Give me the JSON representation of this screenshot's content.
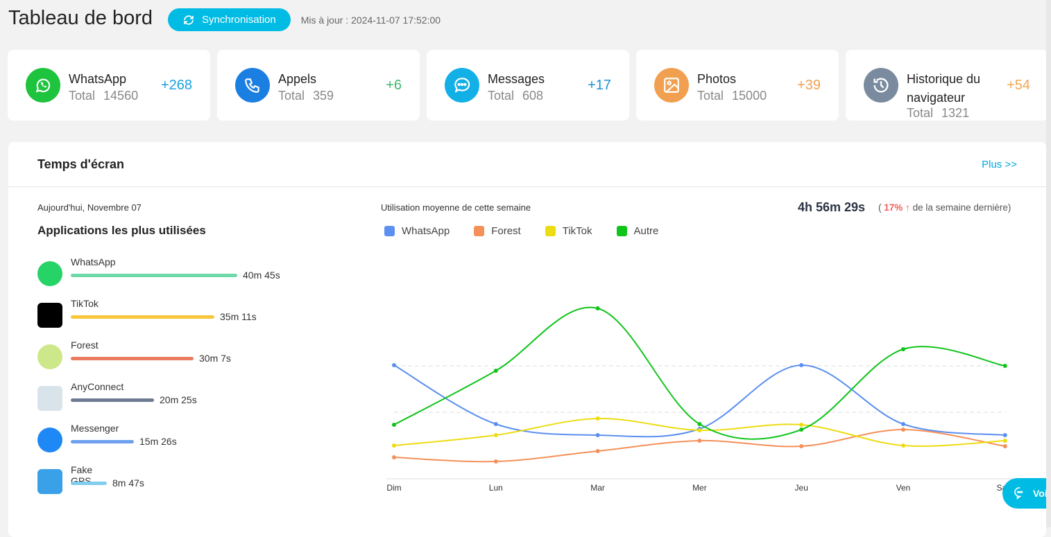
{
  "header": {
    "title": "Tableau de bord",
    "sync_label": "Synchronisation",
    "updated": "Mis à jour : 2024-11-07 17:52:00"
  },
  "cards": [
    {
      "name": "WhatsApp",
      "total_label": "Total",
      "total": "14560",
      "delta": "+268",
      "color": "#1ec33e",
      "delta_color": "#1aa0e0",
      "icon": "whatsapp-icon"
    },
    {
      "name": "Appels",
      "total_label": "Total",
      "total": "359",
      "delta": "+6",
      "color": "#1a7fe0",
      "delta_color": "#3cb86a",
      "icon": "phone-icon"
    },
    {
      "name": "Messages",
      "total_label": "Total",
      "total": "608",
      "delta": "+17",
      "color": "#12b0e6",
      "delta_color": "#1a8fd8",
      "icon": "chat-icon"
    },
    {
      "name": "Photos",
      "total_label": "Total",
      "total": "15000",
      "delta": "+39",
      "color": "#f0a050",
      "delta_color": "#f0a050",
      "icon": "image-icon"
    },
    {
      "name": "Historique du navigateur",
      "total_label": "Total",
      "total": "1321",
      "delta": "+54",
      "color": "#7a8ba0",
      "delta_color": "#f0a850",
      "icon": "history-icon"
    }
  ],
  "screen_time": {
    "title": "Temps d'écran",
    "more": "Plus >>",
    "date": "Aujourd'hui, Novembre 07",
    "top_apps_title": "Applications les plus utilisées",
    "apps": [
      {
        "name": "WhatsApp",
        "time": "40m 45s",
        "fraction": 1.0,
        "color": "#6dd9a8"
      },
      {
        "name": "TikTok",
        "time": "35m 11s",
        "fraction": 0.863,
        "color": "#f8c63c"
      },
      {
        "name": "Forest",
        "time": "30m 7s",
        "fraction": 0.739,
        "color": "#ea7a60"
      },
      {
        "name": "AnyConnect",
        "time": "20m 25s",
        "fraction": 0.501,
        "color": "#6d7a93"
      },
      {
        "name": "Messenger",
        "time": "15m 26s",
        "fraction": 0.379,
        "color": "#6ea0ee"
      },
      {
        "name": "Fake GPS",
        "time": "8m 47s",
        "fraction": 0.216,
        "color": "#80cdee"
      }
    ],
    "avg_label": "Utilisation moyenne de cette semaine",
    "avg_total": "4h 56m 29s",
    "compare_open": "(",
    "compare_pct": "17%",
    "compare_arrow": "↑",
    "compare_text": "de la semaine dernière)"
  },
  "chart_data": {
    "type": "line",
    "categories": [
      "Dim",
      "Lun",
      "Mar",
      "Mer",
      "Jeu",
      "Ven",
      "Sam"
    ],
    "series": [
      {
        "name": "WhatsApp",
        "color": "#5b8ff0",
        "values": [
          16.4,
          7.9,
          6.3,
          7.2,
          16.4,
          7.9,
          6.3
        ]
      },
      {
        "name": "Forest",
        "color": "#f59058",
        "values": [
          3.1,
          2.5,
          4.0,
          5.5,
          4.7,
          7.1,
          4.7
        ]
      },
      {
        "name": "TikTok",
        "color": "#ecdc10",
        "values": [
          4.8,
          6.3,
          8.7,
          7.0,
          7.8,
          4.8,
          5.5
        ]
      },
      {
        "name": "Autre",
        "color": "#10c41a",
        "values": [
          7.8,
          15.6,
          24.6,
          7.9,
          7.1,
          18.7,
          16.3
        ]
      }
    ],
    "ylim": [
      0,
      26
    ],
    "grid": "dashed horizontal",
    "legend": "top-left"
  },
  "chat_button": {
    "label": "Voir"
  }
}
